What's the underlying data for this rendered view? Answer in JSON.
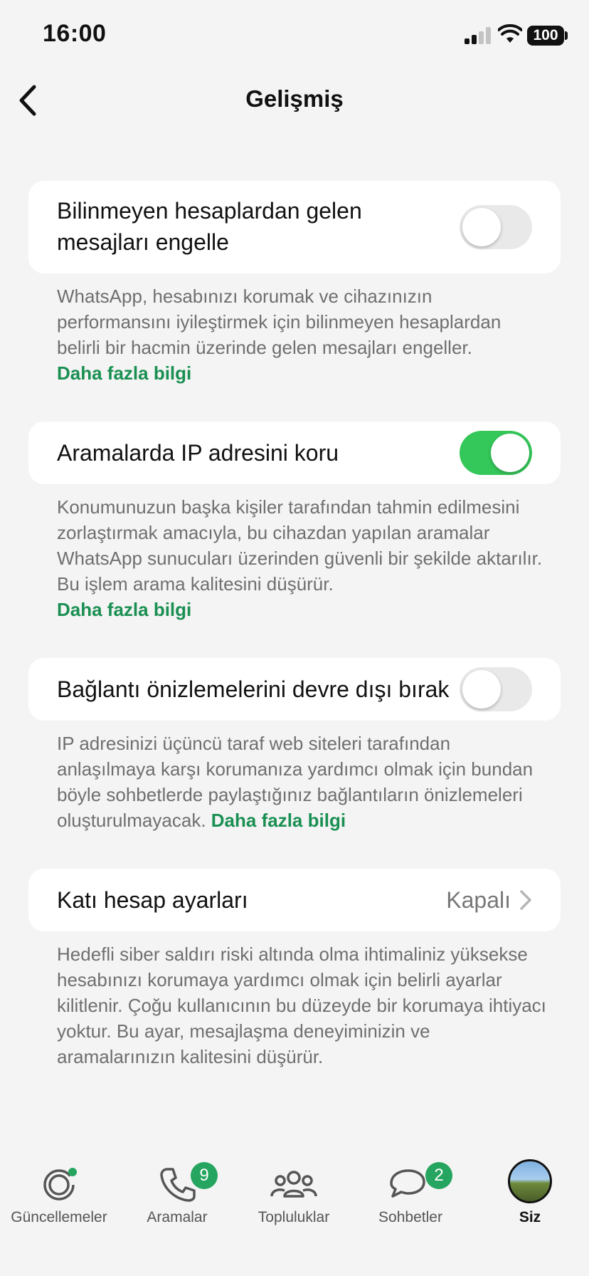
{
  "status_bar": {
    "time": "16:00",
    "battery": "100"
  },
  "nav": {
    "title": "Gelişmiş"
  },
  "settings": {
    "block_unknown": {
      "label_line1": "Bilinmeyen hesaplardan gelen",
      "label_line2": "mesajları engelle",
      "enabled": false,
      "description": "WhatsApp, hesabınızı korumak ve cihazınızın performansını iyileştirmek için bilinmeyen hesaplardan belirli bir hacmin üzerinde gelen mesajları engeller.",
      "link": "Daha fazla bilgi"
    },
    "protect_ip": {
      "label": "Aramalarda IP adresini koru",
      "enabled": true,
      "description": "Konumunuzun başka kişiler tarafından tahmin edilmesini zorlaştırmak amacıyla, bu cihazdan yapılan aramalar WhatsApp sunucuları üzerinden güvenli bir şekilde aktarılır. Bu işlem arama kalitesini düşürür.",
      "link": "Daha fazla bilgi"
    },
    "link_previews": {
      "label": "Bağlantı önizlemelerini devre dışı bırak",
      "enabled": false,
      "description": "IP adresinizi üçüncü taraf web siteleri tarafından anlaşılmaya karşı korumanıza yardımcı olmak için bundan böyle sohbetlerde paylaştığınız bağlantıların önizlemeleri oluşturulmayacak.",
      "link": "Daha fazla bilgi"
    },
    "strict_account": {
      "label": "Katı hesap ayarları",
      "value": "Kapalı",
      "description": "Hedefli siber saldırı riski altında olma ihtimaliniz yüksekse hesabınızı korumaya yardımcı olmak için belirli ayarlar kilitlenir. Çoğu kullanıcının bu düzeyde bir korumaya ihtiyacı yoktur. Bu ayar, mesajlaşma deneyiminizin ve aramalarınızın kalitesini düşürür."
    }
  },
  "tabs": [
    {
      "label": "Güncellemeler",
      "icon": "updates-icon"
    },
    {
      "label": "Aramalar",
      "icon": "phone-icon",
      "badge": "9"
    },
    {
      "label": "Topluluklar",
      "icon": "communities-icon"
    },
    {
      "label": "Sohbetler",
      "icon": "chats-icon",
      "badge": "2"
    },
    {
      "label": "Siz",
      "icon": "avatar"
    }
  ],
  "colors": {
    "accent": "#25a55f",
    "toggle_on": "#34c759",
    "link": "#1a8f52",
    "background": "#f4f4f4"
  }
}
